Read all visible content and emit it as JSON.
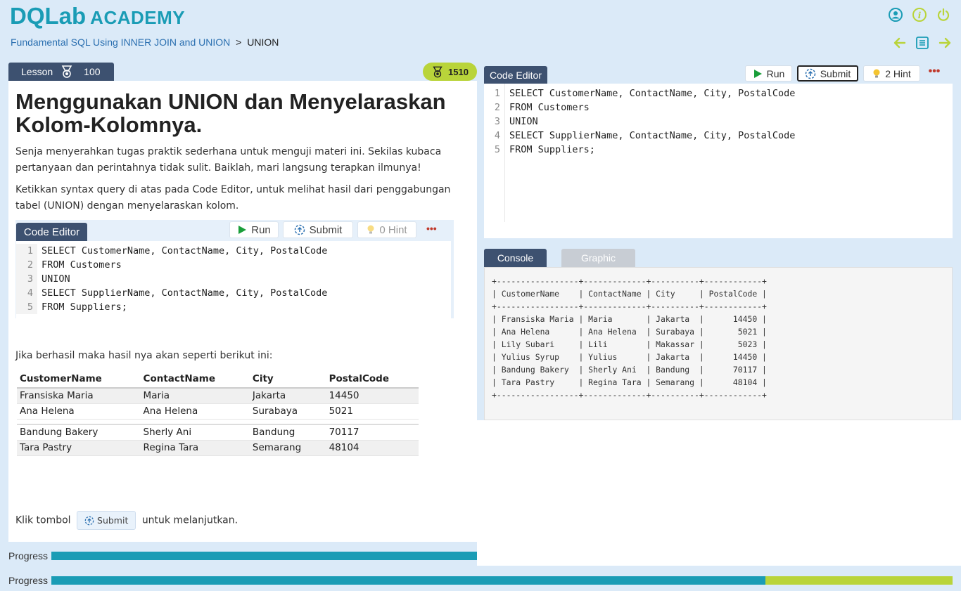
{
  "logo": {
    "brand": "DQLab",
    "academy": "ACADEMY"
  },
  "header_icons": [
    "user-circle-icon",
    "info-icon",
    "power-icon"
  ],
  "breadcrumb": {
    "parent": "Fundamental SQL Using INNER JOIN and UNION",
    "separator": ">",
    "current": "UNION"
  },
  "nav_icons": [
    "arrow-left-icon",
    "list-icon",
    "arrow-right-icon"
  ],
  "lesson_tab": {
    "label": "Lesson",
    "score": "100"
  },
  "points": "1510",
  "lesson": {
    "title": "Menggunakan UNION dan Menyelaraskan Kolom-Kolomnya.",
    "para1": "Senja menyerahkan tugas praktik sederhana untuk menguji materi ini. Sekilas kubaca pertanyaan dan perintahnya tidak sulit. Baiklah, mari langsung terapkan ilmunya!",
    "para2": "Ketikkan syntax query di atas pada Code Editor, untuk melihat hasil dari penggabungan tabel (UNION) dengan menyelaraskan kolom.",
    "mini_editor": {
      "tab": "Code Editor",
      "run": "Run",
      "submit": "Submit",
      "hint": "0 Hint",
      "more": "•••"
    },
    "para3": "Jika berhasil maka hasil nya akan seperti berikut ini:",
    "table": {
      "headers": [
        "CustomerName",
        "ContactName",
        "City",
        "PostalCode"
      ],
      "rows": [
        [
          "Fransiska Maria",
          "Maria",
          "Jakarta",
          "14450"
        ],
        [
          "Ana Helena",
          "Ana Helena",
          "Surabaya",
          "5021"
        ],
        [
          "Bandung Bakery",
          "Sherly Ani",
          "Bandung",
          "70117"
        ],
        [
          "Tara Pastry",
          "Regina Tara",
          "Semarang",
          "48104"
        ]
      ]
    },
    "closing_before": "Klik tombol",
    "closing_button": "Submit",
    "closing_after": "untuk melanjutkan."
  },
  "code": [
    "SELECT CustomerName, ContactName, City, PostalCode",
    "FROM Customers",
    "UNION",
    "SELECT SupplierName, ContactName, City, PostalCode",
    "FROM Suppliers;"
  ],
  "line_numbers": [
    "1",
    "2",
    "3",
    "4",
    "5"
  ],
  "editor": {
    "tab": "Code Editor",
    "run": "Run",
    "submit": "Submit",
    "hint": "2 Hint",
    "more": "•••"
  },
  "console": {
    "tab_console": "Console",
    "tab_graphic": "Graphic",
    "output": "+-----------------+-------------+----------+------------+\n| CustomerName    | ContactName | City     | PostalCode |\n+-----------------+-------------+----------+------------+\n| Fransiska Maria | Maria       | Jakarta  |      14450 |\n| Ana Helena      | Ana Helena  | Surabaya |       5021 |\n| Lily Subari     | Lili        | Makassar |       5023 |\n| Yulius Syrup    | Yulius      | Jakarta  |      14450 |\n| Bandung Bakery  | Sherly Ani  | Bandung  |      70117 |\n| Tara Pastry     | Regina Tara | Semarang |      48104 |\n+-----------------+-------------+----------+------------+"
  },
  "progress": {
    "label": "Progress",
    "bar1_fraction": 0.5,
    "bar2_fraction": 0.792
  },
  "colors": {
    "navy": "#3d5170",
    "teal": "#1a9cb5",
    "lime": "#b9d43a"
  }
}
